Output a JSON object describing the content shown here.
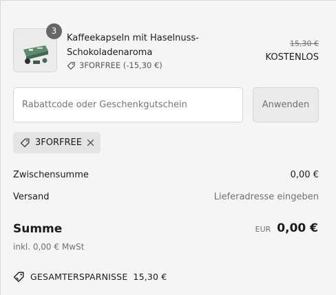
{
  "product": {
    "quantity": "3",
    "name": "Kaffeekapseln mit Haselnuss-Schokoladenaroma",
    "discount_line": "3FORFREE (-15,30 €)",
    "price_original": "15,30 €",
    "price_now": "KOSTENLOS",
    "image_icon": "coffee-capsule-package-image"
  },
  "discount": {
    "placeholder": "Rabattcode oder Geschenkgutschein",
    "apply_label": "Anwenden",
    "applied_code": "3FORFREE"
  },
  "summary": {
    "subtotal_label": "Zwischensumme",
    "subtotal_value": "0,00 €",
    "shipping_label": "Versand",
    "shipping_value": "Lieferadresse eingeben",
    "total_label": "Summe",
    "total_currency": "EUR",
    "total_value": "0,00 €",
    "tax_note": "inkl. 0,00 € MwSt",
    "savings_label": "GESAMTERSPARNISSE",
    "savings_value": "15,30 €"
  },
  "colors": {
    "background": "#f5f5f5",
    "text": "#1a1a1a",
    "muted": "#707070",
    "badge": "#666666",
    "chip": "#e4e4e4"
  }
}
